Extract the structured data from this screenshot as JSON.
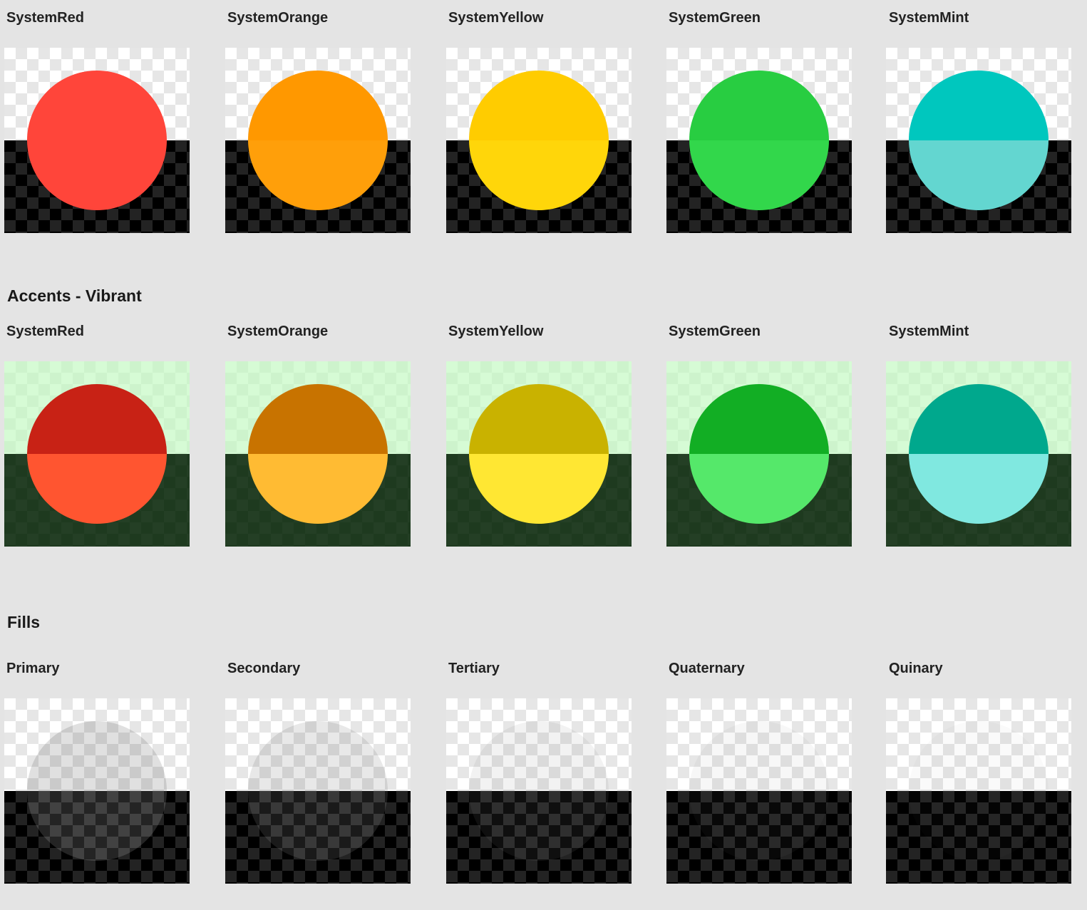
{
  "sections": [
    {
      "title": "",
      "swatches": [
        {
          "label": "SystemRed",
          "top_color": "#ff453a",
          "bottom_color": "#ff453a"
        },
        {
          "label": "SystemOrange",
          "top_color": "#ff9800",
          "bottom_color": "#ff9f0a"
        },
        {
          "label": "SystemYellow",
          "top_color": "#ffcc00",
          "bottom_color": "#ffd60a"
        },
        {
          "label": "SystemGreen",
          "top_color": "#28cd41",
          "bottom_color": "#32d74b"
        },
        {
          "label": "SystemMint",
          "top_color": "#00c7be",
          "bottom_color": "#63d6d0"
        }
      ]
    },
    {
      "title": "Accents - Vibrant",
      "swatches": [
        {
          "label": "SystemRed",
          "top_color": "#c82215",
          "bottom_color": "#ff5530"
        },
        {
          "label": "SystemOrange",
          "top_color": "#c87300",
          "bottom_color": "#ffbb33"
        },
        {
          "label": "SystemYellow",
          "top_color": "#c9b200",
          "bottom_color": "#ffe733"
        },
        {
          "label": "SystemGreen",
          "top_color": "#12ae24",
          "bottom_color": "#55e86a"
        },
        {
          "label": "SystemMint",
          "top_color": "#00a88d",
          "bottom_color": "#80e8e0"
        }
      ]
    },
    {
      "title": "Fills",
      "swatches": [
        {
          "label": "Primary",
          "top_color": "rgba(0,0,0,0.12)",
          "bottom_color": "rgba(255,255,255,0.14)"
        },
        {
          "label": "Secondary",
          "top_color": "rgba(0,0,0,0.09)",
          "bottom_color": "rgba(255,255,255,0.10)"
        },
        {
          "label": "Tertiary",
          "top_color": "rgba(0,0,0,0.05)",
          "bottom_color": "rgba(255,255,255,0.06)"
        },
        {
          "label": "Quaternary",
          "top_color": "rgba(0,0,0,0.03)",
          "bottom_color": "rgba(255,255,255,0.03)"
        },
        {
          "label": "Quinary",
          "top_color": "rgba(0,0,0,0.02)",
          "bottom_color": "rgba(255,255,255,0.015)"
        }
      ]
    }
  ]
}
